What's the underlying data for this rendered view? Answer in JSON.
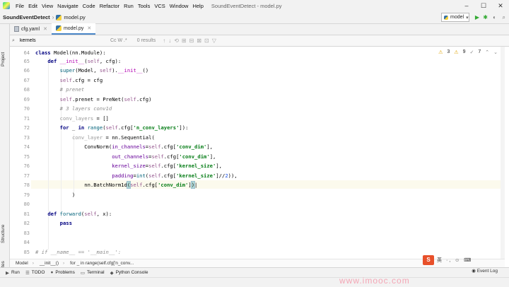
{
  "menu": {
    "items": [
      "File",
      "Edit",
      "View",
      "Navigate",
      "Code",
      "Refactor",
      "Run",
      "Tools",
      "VCS",
      "Window",
      "Help"
    ],
    "window_title": "SoundEventDetect - model.py"
  },
  "navbar": {
    "project": "SoundEventDetect",
    "file": "model.py",
    "run_config": "model"
  },
  "left_tools": {
    "project": "Project",
    "structure": "Structure",
    "favorites": "Favorites"
  },
  "tabs": [
    {
      "label": "cfg.yaml",
      "icon": "yaml-file-icon",
      "active": false
    },
    {
      "label": "model.py",
      "icon": "python-file-icon",
      "active": true
    }
  ],
  "find": {
    "query": "kernels",
    "options": "Cc W .*",
    "results": "0 results"
  },
  "inspections": {
    "warnings": "3",
    "weak_warnings": "9",
    "typos": "7"
  },
  "code": {
    "lines": [
      64,
      65,
      66,
      67,
      68,
      69,
      70,
      71,
      72,
      73,
      74,
      75,
      76,
      77,
      78,
      79,
      80,
      81,
      82,
      83,
      84,
      85
    ],
    "current_line": 78
  },
  "breadcrumb": [
    "Model",
    "__init__()",
    "for _ in range(self.cfg['n_conv..."
  ],
  "bottom_tools": [
    {
      "label": "Run",
      "icon": "run-icon"
    },
    {
      "label": "TODO",
      "icon": "todo-icon"
    },
    {
      "label": "Problems",
      "icon": "problems-icon"
    },
    {
      "label": "Terminal",
      "icon": "terminal-icon"
    },
    {
      "label": "Python Console",
      "icon": "python-console-icon"
    }
  ],
  "event_log": "Event Log",
  "ime": {
    "badge": "S",
    "text": "英 ·, ☺ ⌨"
  },
  "watermark": "www.imooc.com"
}
